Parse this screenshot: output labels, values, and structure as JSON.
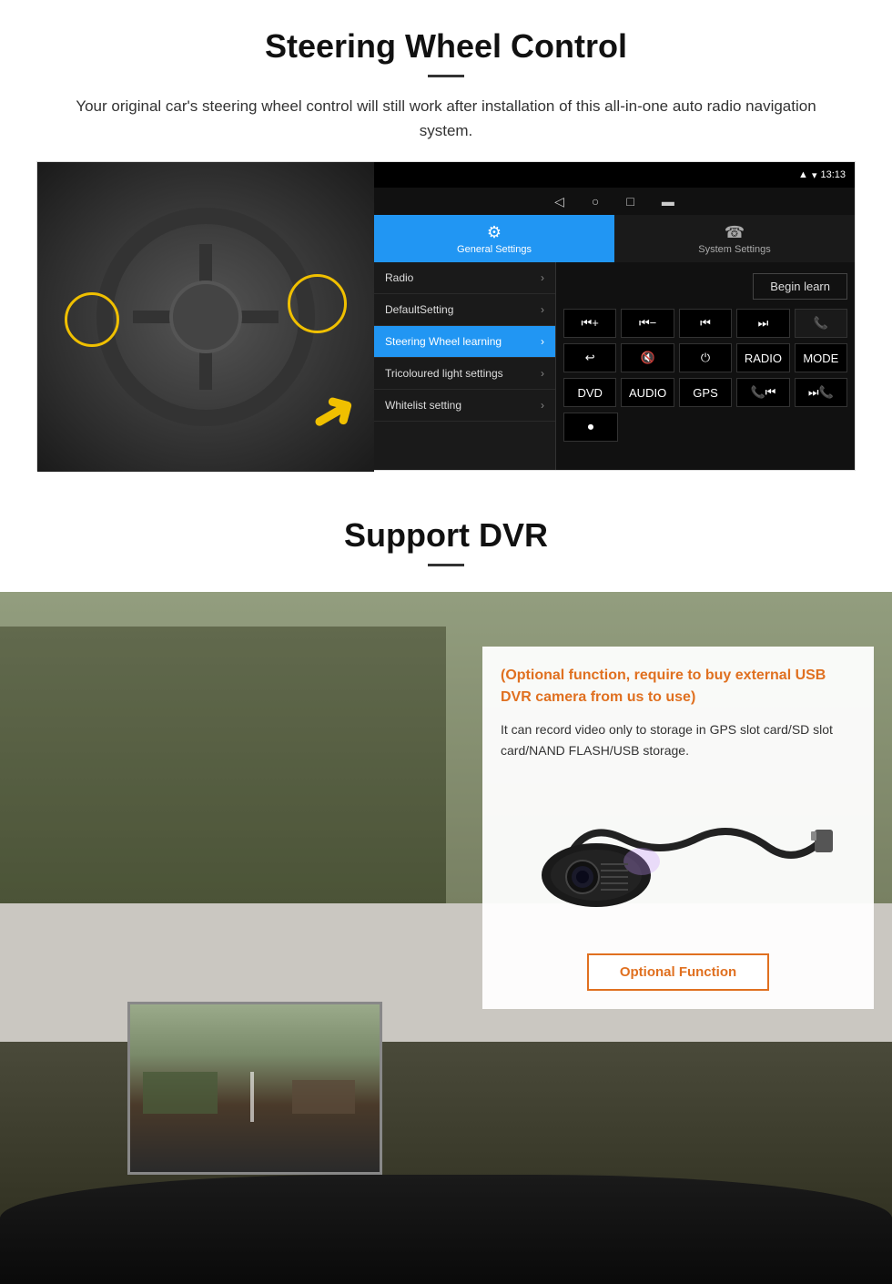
{
  "steering": {
    "title": "Steering Wheel Control",
    "subtitle": "Your original car's steering wheel control will still work after installation of this all-in-one auto radio navigation system.",
    "statusbar": {
      "signal": "9",
      "wifi": "▾",
      "time": "13:13"
    },
    "nav_buttons": [
      "◁",
      "○",
      "□",
      "▬"
    ],
    "tabs": {
      "general": {
        "icon": "⚙",
        "label": "General Settings"
      },
      "system": {
        "icon": "☎",
        "label": "System Settings"
      }
    },
    "menu_items": [
      {
        "label": "Radio",
        "active": false
      },
      {
        "label": "DefaultSetting",
        "active": false
      },
      {
        "label": "Steering Wheel learning",
        "active": true
      },
      {
        "label": "Tricoloured light settings",
        "active": false
      },
      {
        "label": "Whitelist setting",
        "active": false
      }
    ],
    "begin_learn_label": "Begin learn",
    "ctrl_buttons_row1": [
      "⏮+",
      "⏮−",
      "⏮⏮",
      "⏭⏭",
      "📞"
    ],
    "ctrl_buttons_row2": [
      "↩",
      "🔇",
      "⏻",
      "RADIO",
      "MODE"
    ],
    "ctrl_buttons_row3": [
      "DVD",
      "AUDIO",
      "GPS",
      "📞⏮",
      "⏭📞"
    ],
    "ctrl_buttons_row4": [
      "⏺"
    ]
  },
  "dvr": {
    "title": "Support DVR",
    "optional_text": "(Optional function, require to buy external USB DVR camera from us to use)",
    "desc": "It can record video only to storage in GPS slot card/SD slot card/NAND FLASH/USB storage.",
    "optional_fn_label": "Optional Function"
  }
}
